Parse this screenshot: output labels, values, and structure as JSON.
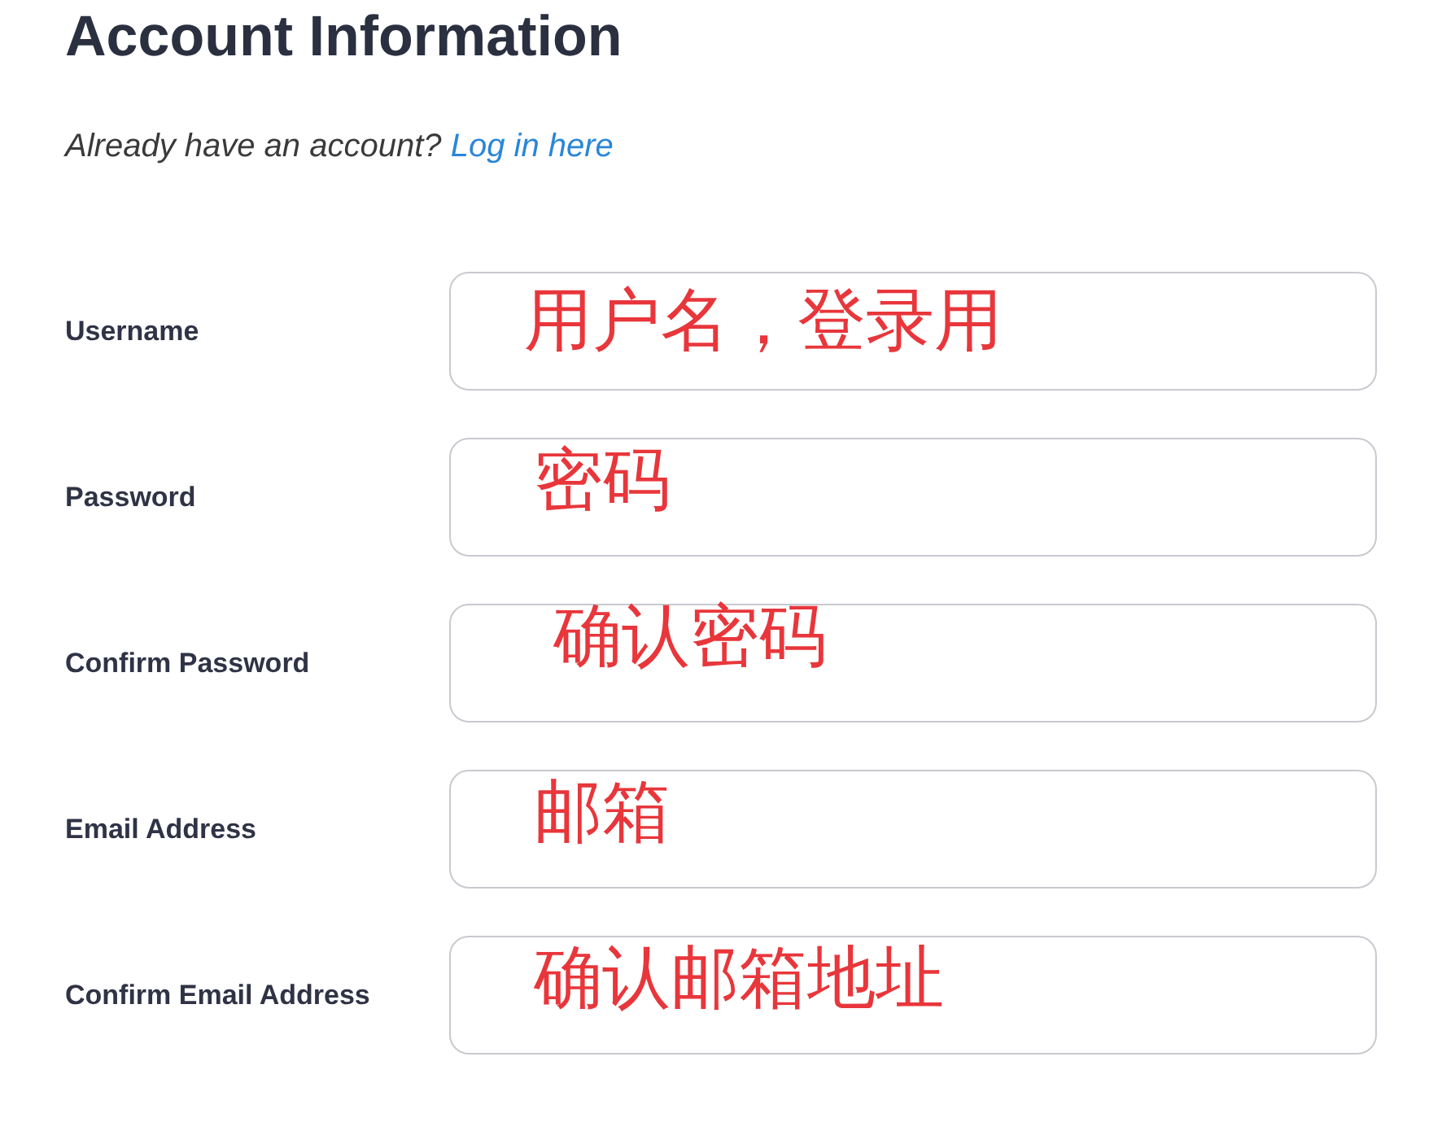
{
  "title": "Account Information",
  "login_prompt": {
    "text": "Already have an account?",
    "link": "Log in here"
  },
  "fields": [
    {
      "label": "Username",
      "annotation": "用户名，登录用"
    },
    {
      "label": "Password",
      "annotation": "密码"
    },
    {
      "label": "Confirm Password",
      "annotation": "确认密码"
    },
    {
      "label": "Email Address",
      "annotation": "邮箱"
    },
    {
      "label": "Confirm Email Address",
      "annotation": "确认邮箱地址"
    }
  ]
}
